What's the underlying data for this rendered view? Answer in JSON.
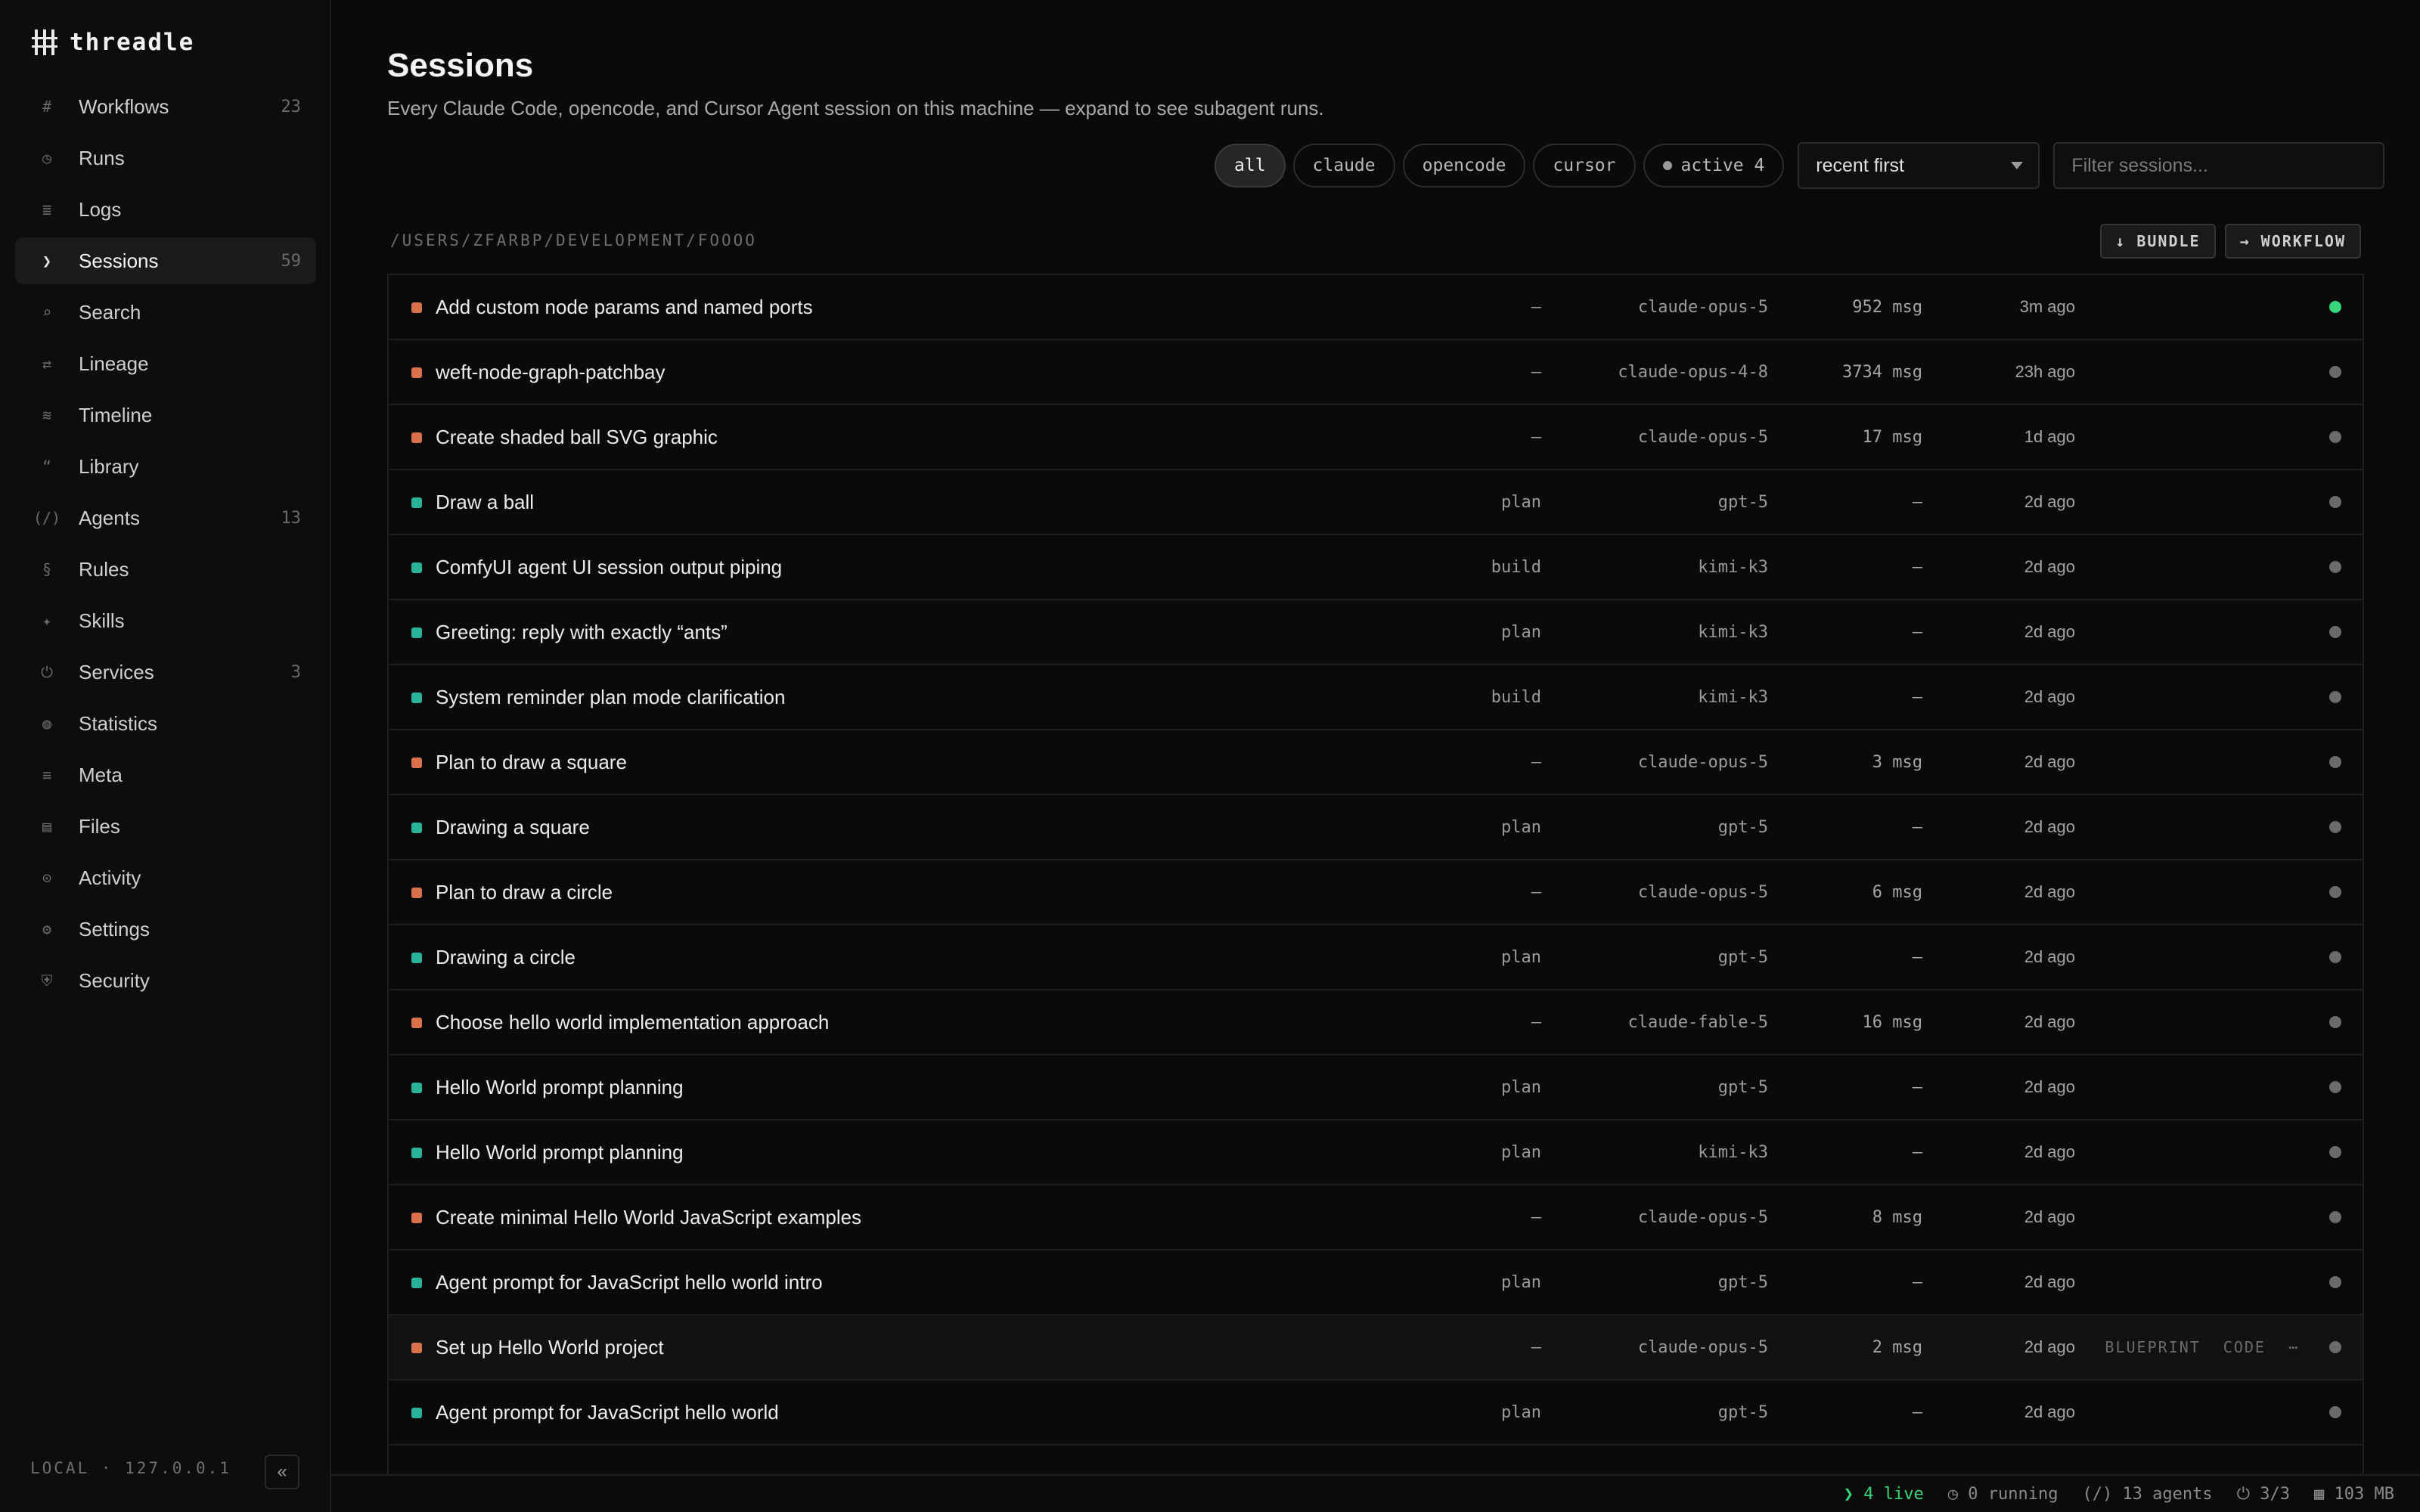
{
  "app": {
    "name": "threadle"
  },
  "sidebar": {
    "items": [
      {
        "label": "Workflows",
        "icon": "#",
        "count": "23"
      },
      {
        "label": "Runs",
        "icon": "◷",
        "count": ""
      },
      {
        "label": "Logs",
        "icon": "≣",
        "count": ""
      },
      {
        "label": "Sessions",
        "icon": "❯",
        "count": "59",
        "active": true
      },
      {
        "label": "Search",
        "icon": "⌕",
        "count": ""
      },
      {
        "label": "Lineage",
        "icon": "⇄",
        "count": ""
      },
      {
        "label": "Timeline",
        "icon": "≋",
        "count": ""
      },
      {
        "label": "Library",
        "icon": "“",
        "count": ""
      },
      {
        "label": "Agents",
        "icon": "(/)",
        "count": "13"
      },
      {
        "label": "Rules",
        "icon": "§",
        "count": ""
      },
      {
        "label": "Skills",
        "icon": "✦",
        "count": ""
      },
      {
        "label": "Services",
        "icon": "⏻",
        "count": "3"
      },
      {
        "label": "Statistics",
        "icon": "◍",
        "count": ""
      },
      {
        "label": "Meta",
        "icon": "≡",
        "count": ""
      },
      {
        "label": "Files",
        "icon": "▤",
        "count": ""
      },
      {
        "label": "Activity",
        "icon": "⊙",
        "count": ""
      },
      {
        "label": "Settings",
        "icon": "⚙",
        "count": ""
      },
      {
        "label": "Security",
        "icon": "⛨",
        "count": ""
      }
    ],
    "footer": "LOCAL · 127.0.0.1",
    "collapse_label": "«"
  },
  "page": {
    "title": "Sessions",
    "subtitle": "Every Claude Code, opencode, and Cursor Agent session on this machine — expand to see subagent runs."
  },
  "filters": {
    "chips": [
      "all",
      "claude",
      "opencode",
      "cursor"
    ],
    "active_chip": "all",
    "active_label": "active 4",
    "sort": "recent first",
    "search_placeholder": "Filter sessions..."
  },
  "group": {
    "path": "/USERS/ZFARBP/DEVELOPMENT/FOOOO",
    "bundle_label": "↓ BUNDLE",
    "workflow_label": "→ WORKFLOW"
  },
  "row_actions": {
    "blueprint": "BLUEPRINT",
    "code": "CODE",
    "more": "⋯"
  },
  "sessions": [
    {
      "source": "claude",
      "title": "Add custom node params and named ports",
      "mode": "—",
      "model": "claude-opus-5",
      "msgs": "952 msg",
      "time": "3m ago",
      "live": true
    },
    {
      "source": "claude",
      "title": "weft-node-graph-patchbay",
      "mode": "—",
      "model": "claude-opus-4-8",
      "msgs": "3734 msg",
      "time": "23h ago"
    },
    {
      "source": "claude",
      "title": "Create shaded ball SVG graphic",
      "mode": "—",
      "model": "claude-opus-5",
      "msgs": "17 msg",
      "time": "1d ago"
    },
    {
      "source": "opencode",
      "title": "Draw a ball",
      "mode": "plan",
      "model": "gpt-5",
      "msgs": "—",
      "time": "2d ago"
    },
    {
      "source": "opencode",
      "title": "ComfyUI agent UI session output piping",
      "mode": "build",
      "model": "kimi-k3",
      "msgs": "—",
      "time": "2d ago"
    },
    {
      "source": "opencode",
      "title": "Greeting: reply with exactly “ants”",
      "mode": "plan",
      "model": "kimi-k3",
      "msgs": "—",
      "time": "2d ago"
    },
    {
      "source": "opencode",
      "title": "System reminder plan mode clarification",
      "mode": "build",
      "model": "kimi-k3",
      "msgs": "—",
      "time": "2d ago"
    },
    {
      "source": "claude",
      "title": "Plan to draw a square",
      "mode": "—",
      "model": "claude-opus-5",
      "msgs": "3 msg",
      "time": "2d ago"
    },
    {
      "source": "opencode",
      "title": "Drawing a square",
      "mode": "plan",
      "model": "gpt-5",
      "msgs": "—",
      "time": "2d ago"
    },
    {
      "source": "claude",
      "title": "Plan to draw a circle",
      "mode": "—",
      "model": "claude-opus-5",
      "msgs": "6 msg",
      "time": "2d ago"
    },
    {
      "source": "opencode",
      "title": "Drawing a circle",
      "mode": "plan",
      "model": "gpt-5",
      "msgs": "—",
      "time": "2d ago"
    },
    {
      "source": "claude",
      "title": "Choose hello world implementation approach",
      "mode": "—",
      "model": "claude-fable-5",
      "msgs": "16 msg",
      "time": "2d ago"
    },
    {
      "source": "opencode",
      "title": "Hello World prompt planning",
      "mode": "plan",
      "model": "gpt-5",
      "msgs": "—",
      "time": "2d ago"
    },
    {
      "source": "opencode",
      "title": "Hello World prompt planning",
      "mode": "plan",
      "model": "kimi-k3",
      "msgs": "—",
      "time": "2d ago"
    },
    {
      "source": "claude",
      "title": "Create minimal Hello World JavaScript examples",
      "mode": "—",
      "model": "claude-opus-5",
      "msgs": "8 msg",
      "time": "2d ago"
    },
    {
      "source": "opencode",
      "title": "Agent prompt for JavaScript hello world intro",
      "mode": "plan",
      "model": "gpt-5",
      "msgs": "—",
      "time": "2d ago"
    },
    {
      "source": "claude",
      "title": "Set up Hello World project",
      "mode": "—",
      "model": "claude-opus-5",
      "msgs": "2 msg",
      "time": "2d ago",
      "hover": true
    },
    {
      "source": "opencode",
      "title": "Agent prompt for JavaScript hello world",
      "mode": "plan",
      "model": "gpt-5",
      "msgs": "—",
      "time": "2d ago"
    }
  ],
  "statusbar": {
    "live": "❯ 4 live",
    "running": "◷ 0 running",
    "agents": "(/) 13 agents",
    "services": "⏻ 3/3",
    "memory": "▦ 103 MB"
  },
  "colors": {
    "claude": "#d9714f",
    "opencode": "#2ab39b",
    "live": "#37d67a"
  }
}
